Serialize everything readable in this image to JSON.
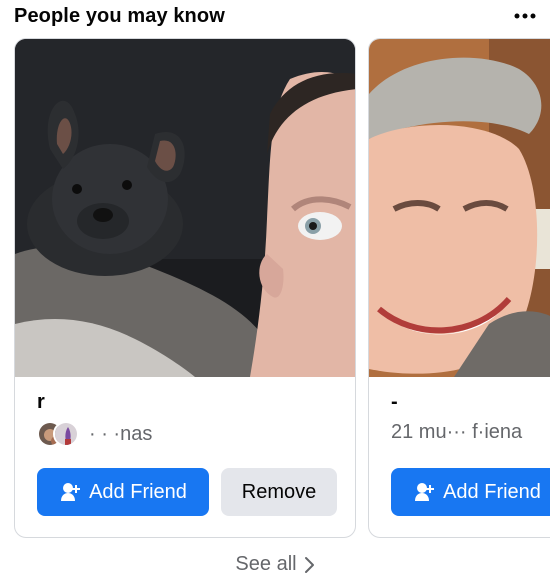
{
  "header": {
    "title": "People you may know",
    "more_icon": "more-dots-icon"
  },
  "cards": [
    {
      "name": "r",
      "mutual_text": "· · ·nas",
      "add_label": "Add Friend",
      "remove_label": "Remove",
      "add_icon": "add-friend-icon"
    },
    {
      "name": "-",
      "mutual_text": "21 mu··· f·iena",
      "add_label": "Add Friend",
      "add_icon": "add-friend-icon"
    }
  ],
  "footer": {
    "see_all": "See all",
    "chevron_icon": "chevron-right-icon"
  },
  "colors": {
    "primary": "#1877f2",
    "secondary": "#e4e6eb",
    "muted_text": "#65676b"
  }
}
